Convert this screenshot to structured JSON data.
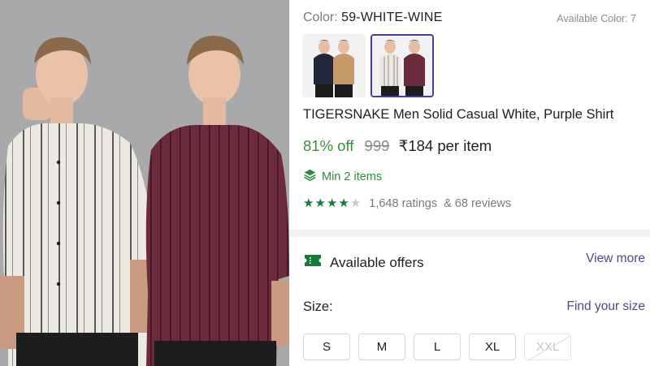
{
  "color": {
    "label": "Color:",
    "value": "59-WHITE-WINE",
    "available_text": "Available Color: 7"
  },
  "swatches": [
    {
      "name": "navy-beige-pair",
      "selected": false
    },
    {
      "name": "white-wine-pair",
      "selected": true
    }
  ],
  "product": {
    "title": "TIGERSNAKE Men Solid Casual White, Purple Shirt"
  },
  "pricing": {
    "discount": "81% off",
    "mrp": "999",
    "price": "₹184 per item"
  },
  "min_order": {
    "icon": "layers-icon",
    "text": "Min 2 items"
  },
  "rating": {
    "stars": 4,
    "ratings_text": "1,648 ratings",
    "reviews_text": "& 68 reviews"
  },
  "offers": {
    "icon": "ticket-icon",
    "label": "Available offers",
    "view_more": "View more"
  },
  "size": {
    "label": "Size:",
    "find_size": "Find your size",
    "options": [
      {
        "label": "S",
        "available": true
      },
      {
        "label": "M",
        "available": true
      },
      {
        "label": "L",
        "available": true
      },
      {
        "label": "XL",
        "available": true
      },
      {
        "label": "XXL",
        "available": false
      }
    ]
  },
  "colors": {
    "accent": "#4a4c8c",
    "green": "#388e3c",
    "swatch_border": "#3f3fa0"
  }
}
